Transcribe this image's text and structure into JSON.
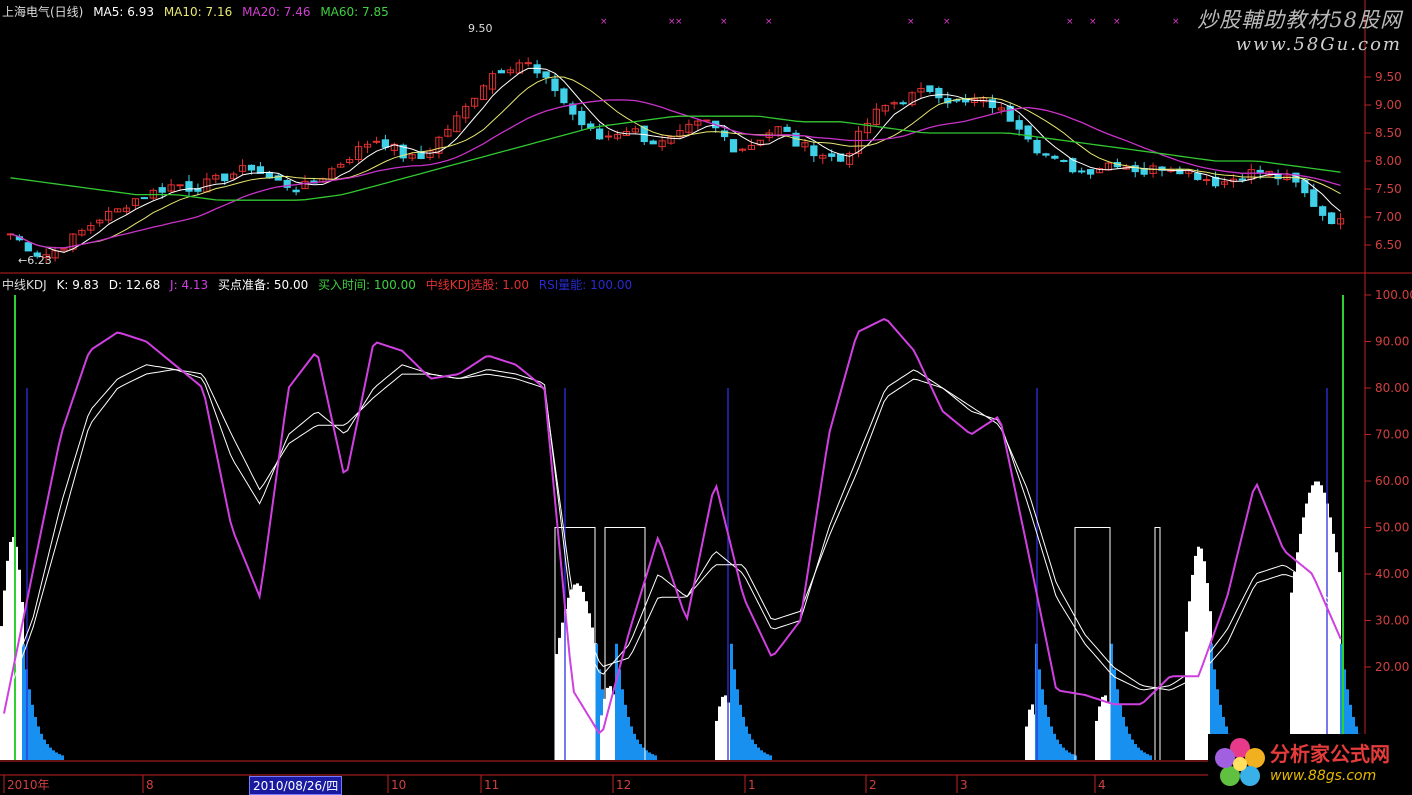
{
  "upper_header": {
    "name": "上海电气(日线)",
    "ma5_label": "MA5: 6.93",
    "ma10_label": "MA10: 7.16",
    "ma20_label": "MA20: 7.46",
    "ma60_label": "MA60: 7.85"
  },
  "lower_header": {
    "name": "中线KDJ",
    "k_label": "K: 9.83",
    "d_label": "D: 12.68",
    "j_label": "J: 4.13",
    "buy_ready": "买点准备: 50.00",
    "buy_time": "买入时间: 100.00",
    "kdj_pick": "中线KDJ选股: 1.00",
    "rsi_label": "RSI量能: 100.00"
  },
  "watermark": {
    "line1": "炒股輔助教材58股网",
    "line2": "www.58Gu.com"
  },
  "logo": {
    "text": "分析家公式网",
    "url": "www.88gs.com"
  },
  "colors": {
    "ma5": "#ffffff",
    "ma10": "#e8e870",
    "ma20": "#c832c8",
    "ma60": "#32c832",
    "up": "#e03030",
    "down": "#40d0e8",
    "k": "#ffffff",
    "d": "#ffffff",
    "j": "#d040e0",
    "hist_white": "#ffffff",
    "hist_blue": "#1890f0",
    "signal": "#3030e0",
    "green_spike": "#30d030",
    "axis": "#c02020"
  },
  "chart_data": [
    {
      "type": "candlestick",
      "title": "上海电气(日线)",
      "yticks": [
        "9.50",
        "9.00",
        "8.50",
        "8.00",
        "7.50",
        "7.00",
        "6.50"
      ],
      "ylim": [
        6.2,
        9.95
      ],
      "annotations": [
        "←6.23",
        "9.50"
      ],
      "close_path": [
        6.7,
        6.5,
        6.3,
        6.4,
        6.6,
        6.8,
        7.0,
        7.1,
        7.3,
        7.4,
        7.5,
        7.6,
        7.5,
        7.6,
        7.7,
        7.8,
        7.9,
        7.7,
        7.6,
        7.5,
        7.6,
        7.8,
        8.0,
        8.2,
        8.4,
        8.3,
        8.1,
        8.0,
        8.3,
        8.6,
        8.9,
        9.3,
        9.6,
        9.7,
        9.8,
        9.5,
        9.3,
        8.9,
        8.6,
        8.4,
        8.5,
        8.6,
        8.4,
        8.3,
        8.4,
        8.6,
        8.7,
        8.5,
        8.2,
        8.3,
        8.5,
        8.6,
        8.3,
        8.2,
        8.1,
        8.0,
        8.4,
        8.8,
        9.0,
        9.1,
        9.2,
        9.3,
        9.1,
        9.0,
        9.1,
        9.0,
        8.8,
        8.6,
        8.2,
        8.0,
        7.9,
        7.8,
        7.9,
        8.0,
        7.9,
        7.8,
        7.9,
        7.9,
        7.8,
        7.7,
        7.6,
        7.7,
        7.8,
        7.8,
        7.7,
        7.6,
        7.3,
        7.0,
        6.9
      ],
      "ma60_path": [
        7.7,
        7.6,
        7.5,
        7.4,
        7.4,
        7.3,
        7.3,
        7.3,
        7.4,
        7.6,
        7.8,
        8.0,
        8.2,
        8.4,
        8.6,
        8.7,
        8.8,
        8.8,
        8.8,
        8.7,
        8.7,
        8.6,
        8.5,
        8.5,
        8.5,
        8.4,
        8.3,
        8.2,
        8.1,
        8.0,
        8.0,
        7.9,
        7.8
      ]
    },
    {
      "type": "line",
      "title": "中线KDJ",
      "yticks": [
        "100.00",
        "90.00",
        "80.00",
        "70.00",
        "60.00",
        "50.00",
        "40.00",
        "30.00",
        "20.00"
      ],
      "ylim": [
        0,
        100
      ],
      "series": [
        {
          "name": "K",
          "values": [
            15,
            30,
            55,
            75,
            82,
            85,
            84,
            82,
            65,
            55,
            70,
            75,
            70,
            80,
            85,
            83,
            82,
            84,
            83,
            81,
            30,
            18,
            25,
            40,
            35,
            45,
            40,
            28,
            30,
            50,
            65,
            80,
            84,
            80,
            75,
            73,
            55,
            35,
            25,
            18,
            15,
            16,
            20,
            28,
            40,
            42,
            38,
            30
          ]
        },
        {
          "name": "D",
          "values": [
            12,
            28,
            50,
            72,
            80,
            83,
            84,
            83,
            70,
            58,
            68,
            72,
            72,
            78,
            83,
            83,
            82,
            83,
            82,
            80,
            35,
            20,
            22,
            35,
            35,
            42,
            42,
            30,
            32,
            48,
            62,
            78,
            82,
            80,
            76,
            72,
            58,
            38,
            27,
            20,
            16,
            15,
            18,
            25,
            38,
            40,
            38,
            32
          ]
        },
        {
          "name": "J",
          "values": [
            10,
            40,
            70,
            88,
            92,
            90,
            85,
            80,
            50,
            35,
            80,
            88,
            60,
            90,
            88,
            82,
            83,
            87,
            85,
            80,
            15,
            5,
            28,
            48,
            30,
            60,
            35,
            22,
            30,
            70,
            92,
            95,
            88,
            75,
            70,
            74,
            45,
            15,
            14,
            12,
            12,
            18,
            18,
            35,
            60,
            45,
            40,
            26
          ]
        }
      ],
      "signals": [
        "买点准备",
        "买入时间",
        "中线KDJ选股",
        "RSI量能"
      ]
    }
  ],
  "x_axis": {
    "labels": [
      "2010年",
      "8",
      "2010/08/26/四",
      "10",
      "11",
      "12",
      "1",
      "2",
      "3",
      "4"
    ]
  }
}
